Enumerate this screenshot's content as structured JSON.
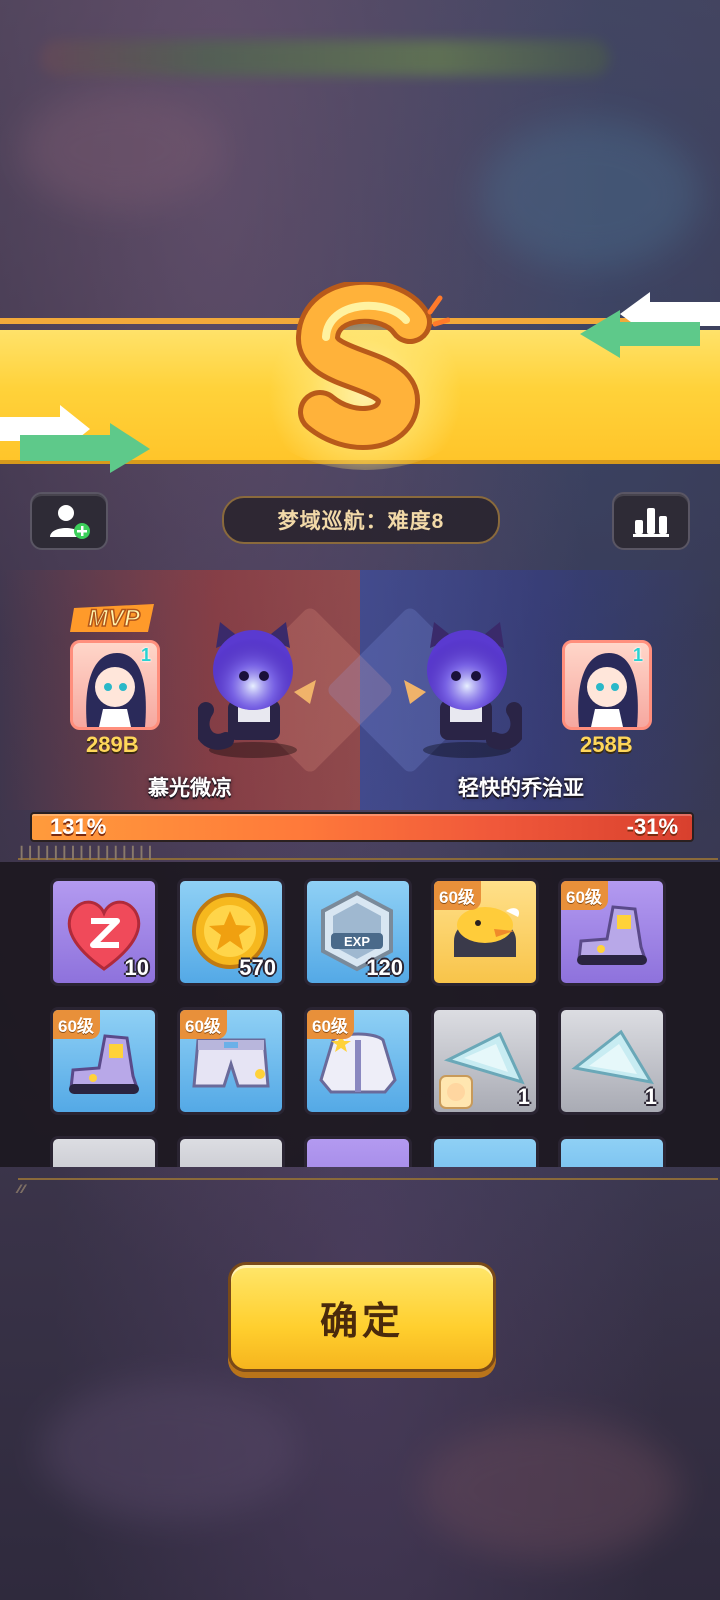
{
  "result": {
    "grade": "S",
    "stage_label": "梦域巡航：难度8"
  },
  "mvp_label": "MVP",
  "players": [
    {
      "name": "慕光微凉",
      "score": "289B",
      "level": "1",
      "share": "131%"
    },
    {
      "name": "轻快的乔治亚",
      "score": "258B",
      "level": "1",
      "share": "-31%"
    }
  ],
  "rewards": [
    {
      "icon": "heart-z-icon",
      "count": "10",
      "bg": "purple"
    },
    {
      "icon": "gold-coin-icon",
      "count": "570",
      "bg": "blue"
    },
    {
      "icon": "exp-badge-icon",
      "count": "120",
      "bg": "blue"
    },
    {
      "icon": "duck-helmet-icon",
      "level": "60级",
      "bg": "gold"
    },
    {
      "icon": "sneaker-icon",
      "level": "60级",
      "bg": "purple"
    },
    {
      "icon": "sneaker-icon",
      "level": "60级",
      "bg": "blue"
    },
    {
      "icon": "shorts-icon",
      "level": "60级",
      "bg": "blue"
    },
    {
      "icon": "jacket-icon",
      "level": "60级",
      "bg": "blue"
    },
    {
      "icon": "crystal-shard-icon",
      "count": "1",
      "bg": "gray"
    },
    {
      "icon": "crystal-shard-icon",
      "count": "1",
      "bg": "gray"
    }
  ],
  "confirm_label": "确定",
  "colors": {
    "banner": "#ffd23a",
    "button": "#ffcf2e",
    "progress_left": "#ff9b3c",
    "progress_right": "#d8402e"
  }
}
